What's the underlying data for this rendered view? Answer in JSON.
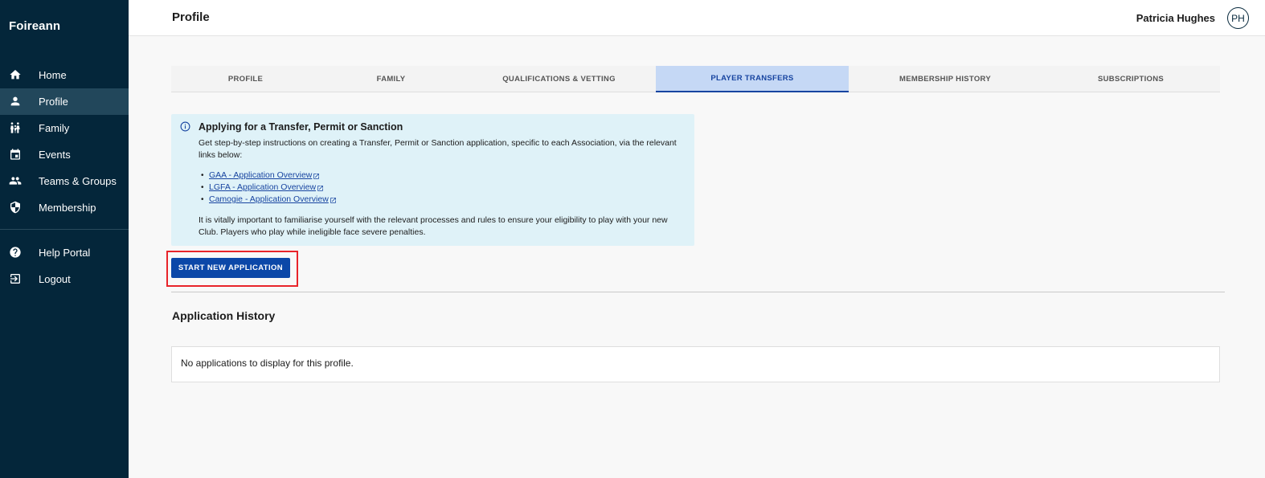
{
  "sidebar": {
    "brand": "Foireann",
    "items": [
      {
        "label": "Home",
        "icon": "home-icon"
      },
      {
        "label": "Profile",
        "icon": "person-icon",
        "active": true
      },
      {
        "label": "Family",
        "icon": "family-icon"
      },
      {
        "label": "Events",
        "icon": "calendar-icon"
      },
      {
        "label": "Teams & Groups",
        "icon": "group-icon"
      },
      {
        "label": "Membership",
        "icon": "shield-icon"
      }
    ],
    "secondary_items": [
      {
        "label": "Help Portal",
        "icon": "help-icon"
      },
      {
        "label": "Logout",
        "icon": "logout-icon"
      }
    ]
  },
  "header": {
    "title": "Profile",
    "user_name": "Patricia Hughes",
    "avatar_initials": "PH"
  },
  "tabs": [
    {
      "label": "PROFILE"
    },
    {
      "label": "FAMILY"
    },
    {
      "label": "QUALIFICATIONS & VETTING"
    },
    {
      "label": "PLAYER TRANSFERS",
      "active": true
    },
    {
      "label": "MEMBERSHIP HISTORY"
    },
    {
      "label": "SUBSCRIPTIONS"
    }
  ],
  "info": {
    "title": "Applying for a Transfer, Permit or Sanction",
    "intro": "Get step-by-step instructions on creating a Transfer, Permit or Sanction application, specific to each Association, via the relevant links below:",
    "links": [
      {
        "label": "GAA - Application Overview"
      },
      {
        "label": "LGFA - Application Overview"
      },
      {
        "label": "Camogie - Application Overview"
      }
    ],
    "footer": "It is vitally important to familiarise yourself with the relevant processes and rules to ensure your eligibility to play with your new Club. Players who play while ineligible face severe penalties."
  },
  "actions": {
    "start_label": "START NEW APPLICATION"
  },
  "history": {
    "title": "Application History",
    "empty_text": "No applications to display for this profile."
  },
  "colors": {
    "sidebar_bg": "#04263a",
    "sidebar_active": "#22475b",
    "accent": "#0b47a8",
    "tab_active_bg": "#c5d8f5",
    "info_bg": "#dff2f8",
    "highlight": "#e8242a"
  }
}
